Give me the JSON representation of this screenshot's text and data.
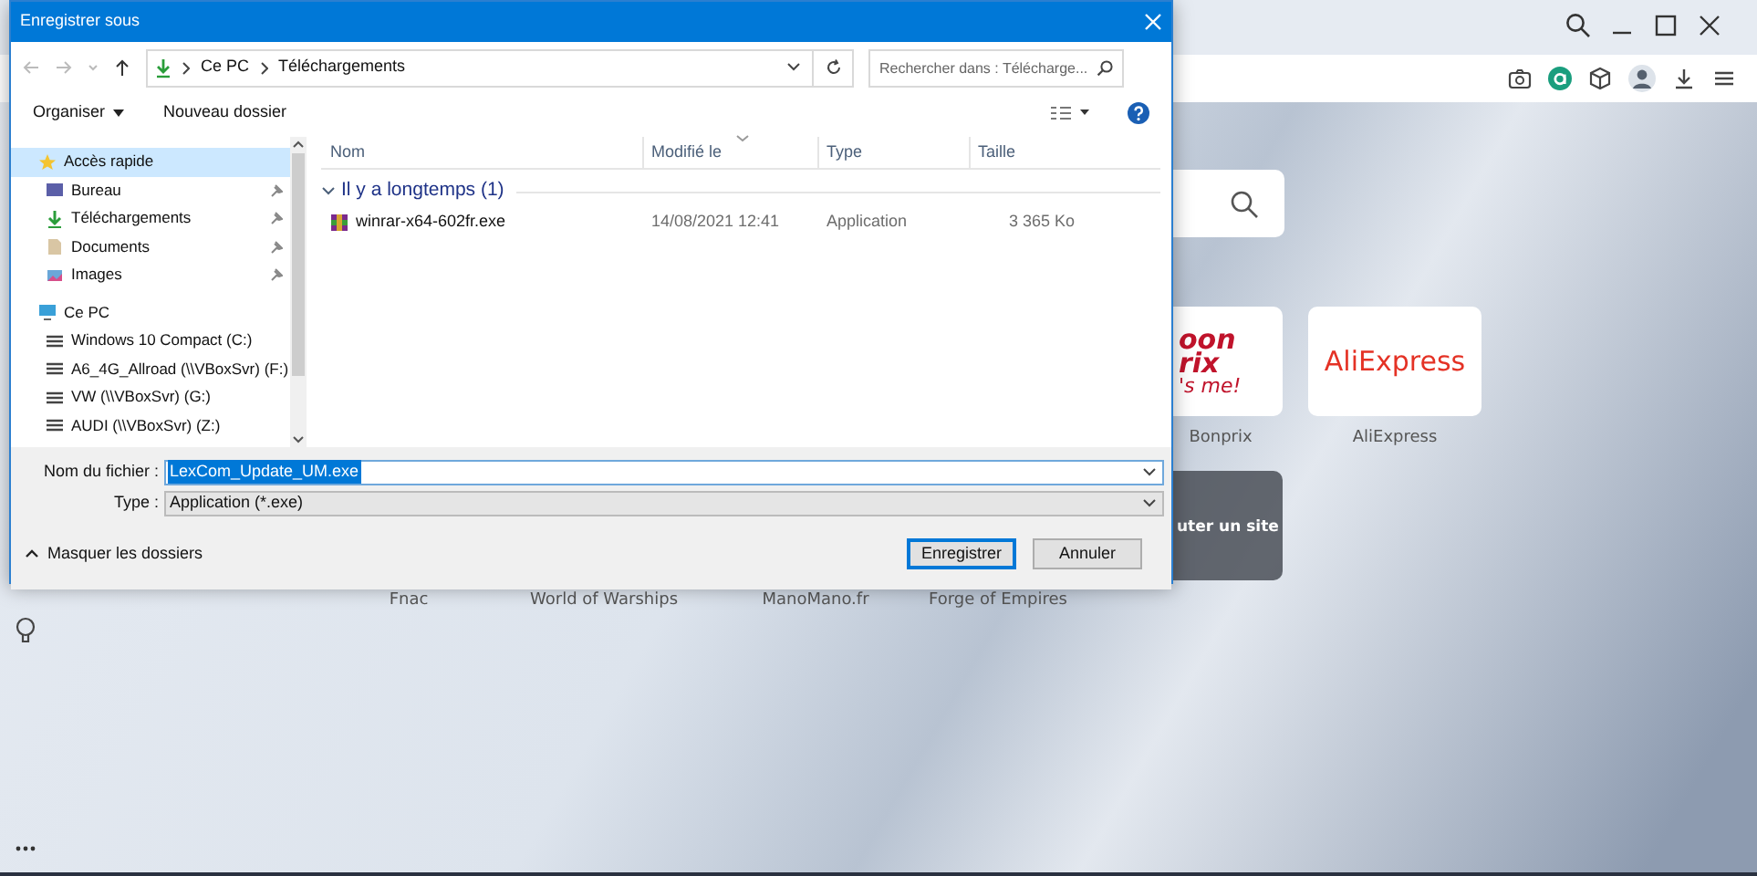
{
  "browser": {
    "tiles": [
      {
        "label": "Bonprix",
        "kind": "bonprix",
        "logo_lines": [
          "oon",
          "rix",
          "'s me!"
        ]
      },
      {
        "label": "AliExpress",
        "kind": "text",
        "logo_lines": [
          "AliExpress"
        ]
      }
    ],
    "add_tile": "uter un site",
    "row2_labels": [
      "Fnac",
      "World of Warships",
      "ManoMano.fr",
      "Forge of Empires"
    ]
  },
  "dialog": {
    "title": "Enregistrer sous",
    "address_path": [
      "Ce PC",
      "Téléchargements"
    ],
    "search": {
      "placeholder": "Rechercher dans : Télécharge..."
    },
    "toolbar": [
      "Organiser",
      "Nouveau dossier"
    ],
    "nav_items": [
      {
        "label": "Accès rapide",
        "selected": true,
        "children": [
          {
            "label": "Bureau",
            "pinned": true,
            "selected": false
          },
          {
            "label": "Téléchargements",
            "pinned": true,
            "selected": false
          },
          {
            "label": "Documents",
            "pinned": true,
            "selected": false
          },
          {
            "label": "Images",
            "pinned": true,
            "selected": false
          }
        ]
      },
      {
        "label": "Ce PC",
        "selected": false,
        "children": [
          {
            "label": "Windows 10 Compact  (C:)",
            "pinned": false,
            "selected": false
          },
          {
            "label": "A6_4G_Allroad (\\\\VBoxSvr) (F:)",
            "pinned": false,
            "selected": false
          },
          {
            "label": "VW (\\\\VBoxSvr) (G:)",
            "pinned": false,
            "selected": false
          },
          {
            "label": "AUDI (\\\\VBoxSvr) (Z:)",
            "pinned": false,
            "selected": false
          }
        ]
      }
    ],
    "columns": [
      "Nom",
      "Modifié le",
      "Type",
      "Taille"
    ],
    "groups": [
      {
        "label": "Il y a longtemps (1)",
        "expanded": true,
        "files": [
          {
            "name": "winrar-x64-602fr.exe",
            "modified": "14/08/2021 12:41",
            "type": "Application",
            "size": "3 365 Ko"
          }
        ]
      }
    ],
    "filename": {
      "label": "Nom du fichier :",
      "value": "LexCom_Update_UM.exe"
    },
    "filetype": {
      "label": "Type :",
      "value": "Application (*.exe)"
    },
    "hide_folders": "Masquer les dossiers",
    "buttons": [
      {
        "label": "Enregistrer",
        "default": true
      },
      {
        "label": "Annuler",
        "default": false
      }
    ]
  }
}
